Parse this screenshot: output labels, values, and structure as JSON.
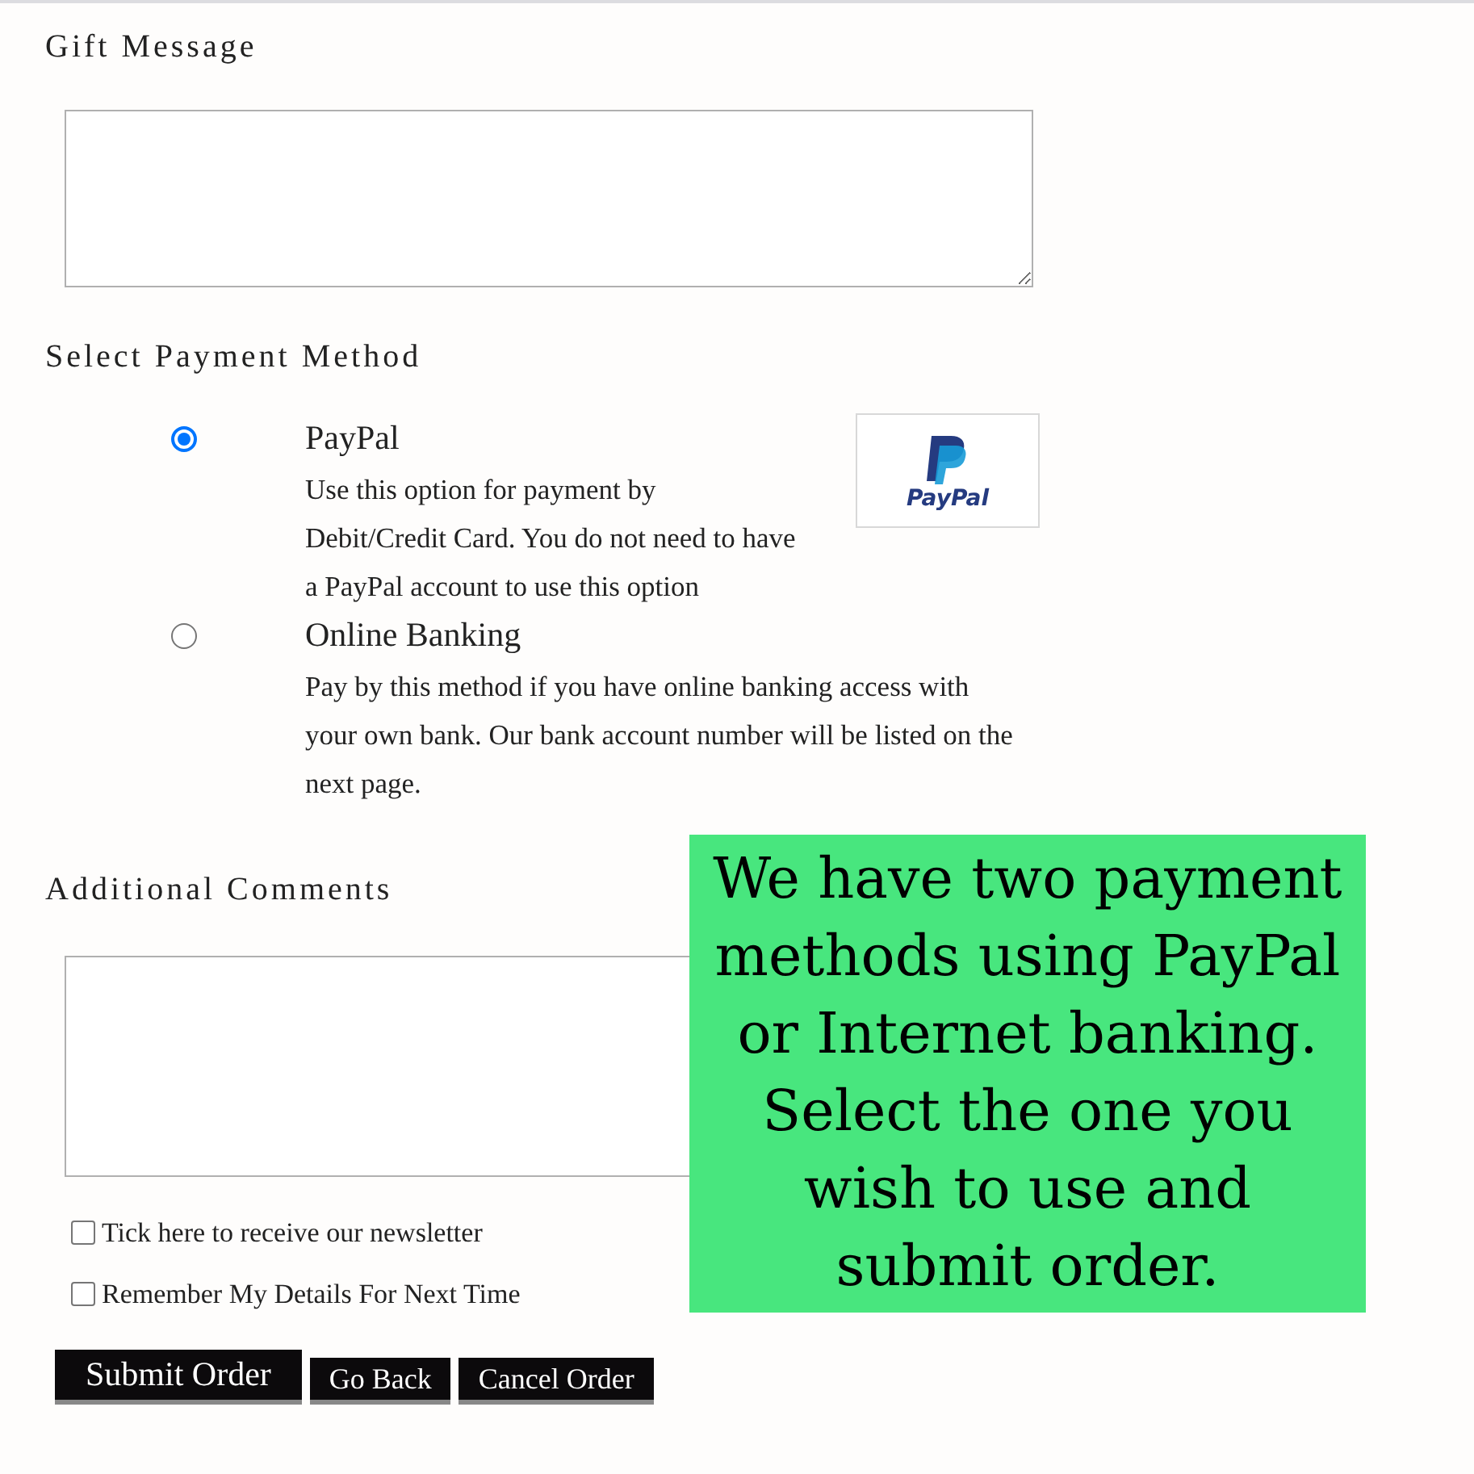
{
  "gift_message": {
    "heading": "Gift Message"
  },
  "payment": {
    "heading": "Select Payment Method",
    "options": [
      {
        "title": "PayPal",
        "description": "Use this option for payment by Debit/Credit Card. You do not need to have a PayPal account to use this option",
        "selected": true,
        "logo_text": "PayPal"
      },
      {
        "title": "Online Banking",
        "description": "Pay by this method if you have online banking access with your own bank. Our bank account number will be listed on the next page.",
        "selected": false
      }
    ]
  },
  "comments": {
    "heading": "Additional Comments"
  },
  "checkboxes": [
    {
      "label": "Tick here to receive our newsletter",
      "checked": false
    },
    {
      "label": "Remember My Details For Next Time",
      "checked": false
    }
  ],
  "buttons": [
    {
      "label": "Submit Order",
      "kind": "primary"
    },
    {
      "label": "Go Back",
      "kind": "secondary"
    },
    {
      "label": "Cancel Order",
      "kind": "secondary"
    }
  ],
  "callout": {
    "text": "We have two payment methods using PayPal or Internet banking. Select the one you wish to use and submit order."
  }
}
